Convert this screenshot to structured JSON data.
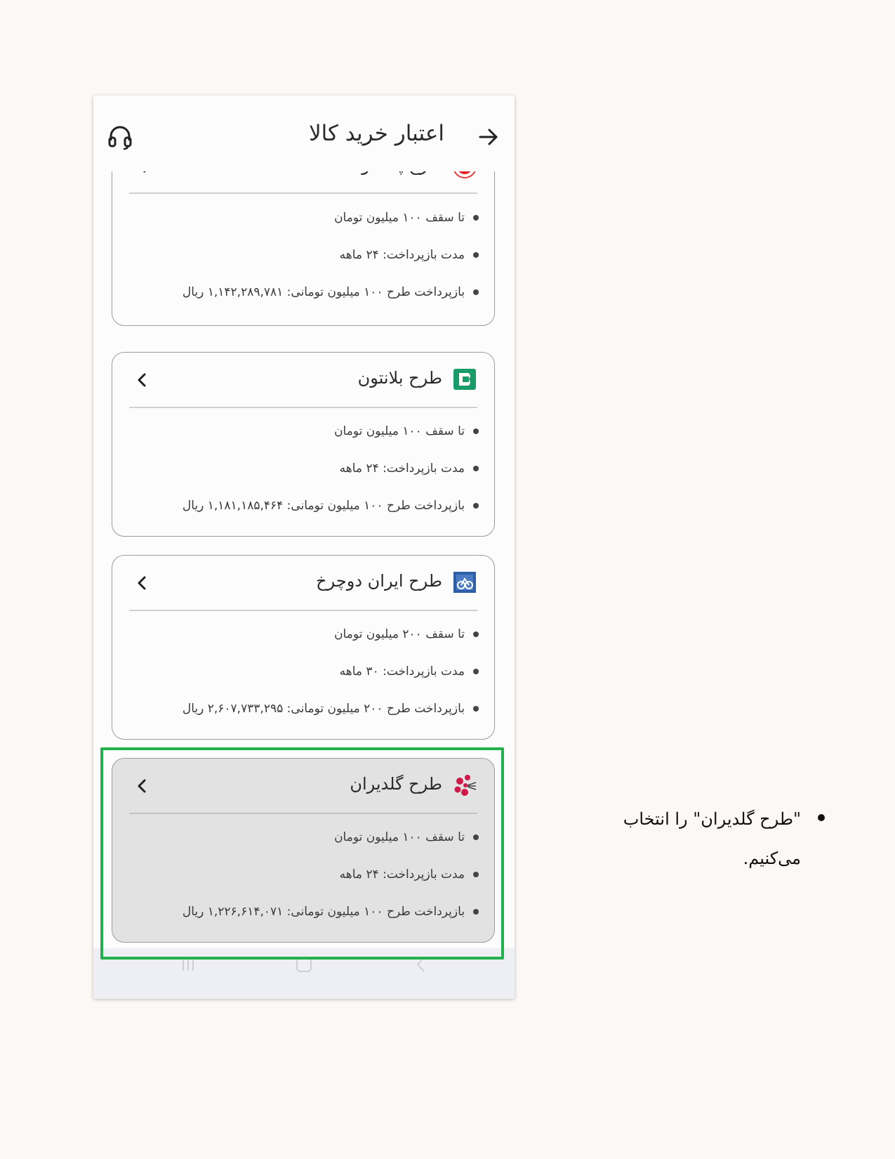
{
  "header": {
    "title": "اعتبار خرید کالا",
    "back_icon": "arrow-right-icon",
    "support_icon": "headset-icon"
  },
  "plans": [
    {
      "name": "طرح پاکشوما",
      "logo": "pakshoma-logo-icon",
      "features": [
        "تا سقف ۱۰۰ میلیون تومان",
        "مدت بازپرداخت: ۲۴ ماهه",
        "بازپرداخت طرح ۱۰۰ میلیون تومانی: ۱,۱۴۲,۲۸۹,۷۸۱ ریال"
      ],
      "selected": false
    },
    {
      "name": "طرح بلانتون",
      "logo": "blanton-logo-icon",
      "features": [
        "تا سقف ۱۰۰ میلیون تومان",
        "مدت بازپرداخت: ۲۴ ماهه",
        "بازپرداخت طرح ۱۰۰ میلیون تومانی: ۱,۱۸۱,۱۸۵,۴۶۴ ریال"
      ],
      "selected": false
    },
    {
      "name": "طرح ایران دوچرخ",
      "logo": "iran-docharkh-logo-icon",
      "features": [
        "تا سقف ۲۰۰ میلیون تومان",
        "مدت بازپرداخت: ۳۰ ماهه",
        "بازپرداخت طرح ۲۰۰ میلیون تومانی: ۲,۶۰۷,۷۳۳,۲۹۵ ریال"
      ],
      "selected": false
    },
    {
      "name": "طرح گلدیران",
      "logo": "goldiran-logo-icon",
      "features": [
        "تا سقف ۱۰۰ میلیون تومان",
        "مدت بازپرداخت: ۲۴ ماهه",
        "بازپرداخت طرح ۱۰۰ میلیون تومانی: ۱,۲۲۶,۶۱۴,۰۷۱ ریال"
      ],
      "selected": true
    }
  ],
  "instruction": {
    "text": "\"طرح گلدیران\" را انتخاب می‌کنیم."
  },
  "colors": {
    "highlight": "#22b14c",
    "selected_card": "#e2e2e2",
    "page_background": "#fcf8f5"
  }
}
